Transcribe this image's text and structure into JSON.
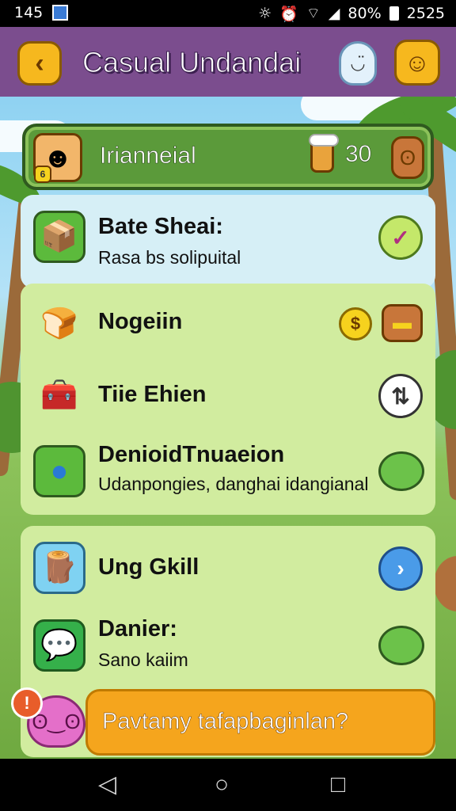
{
  "status_bar": {
    "time": "145",
    "battery": "80%",
    "clock": "2525"
  },
  "app_bar": {
    "title": "Casual Undandai"
  },
  "profile": {
    "name": "Irianneial",
    "avatar_level": "6",
    "coins": "30"
  },
  "rows": [
    {
      "title": "Bate Sheai:",
      "subtitle": "Rasa bs solipuital",
      "action": "check"
    },
    {
      "title": "Nogeiin",
      "subtitle": "",
      "action": "coin-and-folder"
    },
    {
      "title": "Tiie Ehien",
      "subtitle": "",
      "action": "swap"
    },
    {
      "title": "DenioidTnuaeion",
      "subtitle": "Udanpongies, danghai idangianal",
      "action": "green-bubble"
    },
    {
      "title": "Ung Gkill",
      "subtitle": "",
      "action": "forward"
    },
    {
      "title": "Danier:",
      "subtitle": "Sano kaiim",
      "action": "green-bubble"
    }
  ],
  "banner": {
    "text": "Pavtamy tafapbaginlan?"
  },
  "colors": {
    "appbar": "#7b4d8e",
    "accent": "#f6b81e",
    "banner": "#f5a51d",
    "panel": "#d1ec9f"
  },
  "icons": [
    "back-icon",
    "ghost-icon",
    "smiley-icon",
    "cup-icon",
    "coin-button-icon",
    "checkmark-icon",
    "dollar-coin-icon",
    "folder-icon",
    "swap-icon",
    "forward-arrow-icon",
    "green-bubble-icon",
    "alert-icon",
    "pig-icon"
  ]
}
